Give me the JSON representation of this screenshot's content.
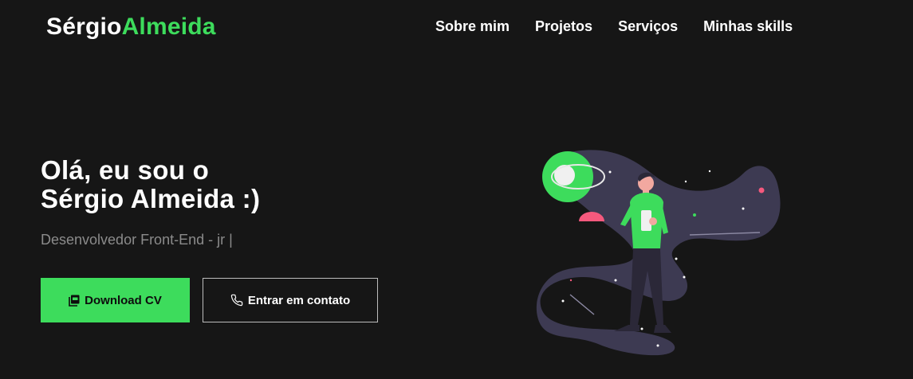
{
  "header": {
    "logo_first": "Sérgio",
    "logo_last": "Almeida",
    "nav": [
      "Sobre mim",
      "Projetos",
      "Serviços",
      "Minhas skills"
    ]
  },
  "hero": {
    "title_line1": "Olá, eu sou o",
    "title_line2": "Sérgio Almeida :)",
    "subtitle": "Desenvolvedor Front-End - jr |",
    "download_label": "Download CV",
    "contact_label": "Entrar em contato"
  },
  "colors": {
    "background": "#161616",
    "accent": "#3ddc5c",
    "nebula": "#3d3a52",
    "pink": "#f5597d"
  },
  "icons": {
    "download": "pdf-file-icon",
    "contact": "phone-icon"
  }
}
